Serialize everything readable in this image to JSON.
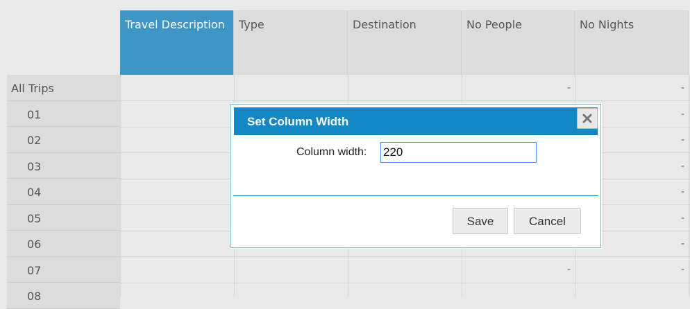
{
  "grid": {
    "columns": [
      "Travel Description",
      "Type",
      "Destination",
      "No People",
      "No Nights"
    ],
    "active_column": "Travel Description",
    "rows": [
      {
        "label": "All Trips",
        "no_people": "-",
        "no_nights": "-"
      },
      {
        "label": "01",
        "no_people": "",
        "no_nights": "-"
      },
      {
        "label": "02",
        "no_people": "",
        "no_nights": "-"
      },
      {
        "label": "03",
        "no_people": "",
        "no_nights": "-"
      },
      {
        "label": "04",
        "no_people": "",
        "no_nights": "-"
      },
      {
        "label": "05",
        "no_people": "",
        "no_nights": "-"
      },
      {
        "label": "06",
        "no_people": "",
        "no_nights": "-"
      },
      {
        "label": "07",
        "no_people": "-",
        "no_nights": "-"
      },
      {
        "label": "08",
        "no_people": "",
        "no_nights": ""
      }
    ]
  },
  "dialog": {
    "title": "Set Column Width",
    "field_label": "Column width:",
    "field_value": "220",
    "save_label": "Save",
    "cancel_label": "Cancel",
    "close_icon": "close-icon"
  },
  "colors": {
    "accent": "#1388c4",
    "active_header": "#3d96c5"
  }
}
